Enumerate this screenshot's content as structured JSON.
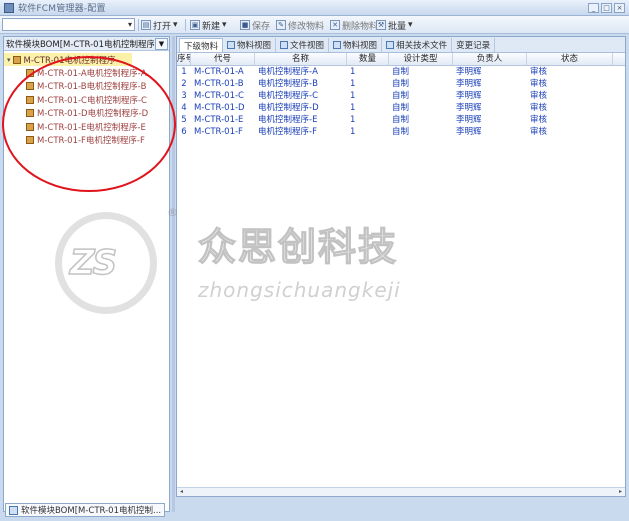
{
  "window": {
    "title": "软件FCM管理器-配置",
    "minimize": "_",
    "maximize": "□",
    "close": "×"
  },
  "toolbar": {
    "select_value": "",
    "open_label": "打开",
    "new_label": "新建",
    "save_label": "保存",
    "modify_label": "修改物料",
    "delete_label": "删除物料",
    "tools_label": "批量"
  },
  "left_panel": {
    "header": "软件模块BOM[M-CTR-01电机控制程序]",
    "tree": {
      "root_label": "M-CTR-01电机控制程序",
      "children": [
        "M-CTR-01-A电机控制程序-A",
        "M-CTR-01-B电机控制程序-B",
        "M-CTR-01-C电机控制程序-C",
        "M-CTR-01-D电机控制程序-D",
        "M-CTR-01-E电机控制程序-E",
        "M-CTR-01-F电机控制程序-F"
      ]
    }
  },
  "tabs": [
    "下级物料",
    "物料视图",
    "文件视图",
    "物料视图",
    "相关技术文件",
    "变更记录"
  ],
  "grid": {
    "headers": [
      "序号",
      "代号",
      "名称",
      "数量",
      "设计类型",
      "负责人",
      "状态"
    ],
    "rows": [
      [
        "1",
        "M-CTR-01-A",
        "电机控制程序-A",
        "1",
        "自制",
        "李明辉",
        "审核"
      ],
      [
        "2",
        "M-CTR-01-B",
        "电机控制程序-B",
        "1",
        "自制",
        "李明辉",
        "审核"
      ],
      [
        "3",
        "M-CTR-01-C",
        "电机控制程序-C",
        "1",
        "自制",
        "李明辉",
        "审核"
      ],
      [
        "4",
        "M-CTR-01-D",
        "电机控制程序-D",
        "1",
        "自制",
        "李明辉",
        "审核"
      ],
      [
        "5",
        "M-CTR-01-E",
        "电机控制程序-E",
        "1",
        "自制",
        "李明辉",
        "审核"
      ],
      [
        "6",
        "M-CTR-01-F",
        "电机控制程序-F",
        "1",
        "自制",
        "李明辉",
        "审核"
      ]
    ]
  },
  "watermark": {
    "letters": "ZS",
    "registered": "®",
    "title": "众思创科技",
    "subtitle": "zhongsichuangkeji"
  },
  "bottom_tab": {
    "label": "软件模块BOM[M-CTR-01电机控制..."
  },
  "colors": {
    "highlight_circle": "#e0141c",
    "grid_text": "#1a3fb8",
    "tree_text": "#8a1c1c",
    "root_bg": "#fbf1a8"
  }
}
